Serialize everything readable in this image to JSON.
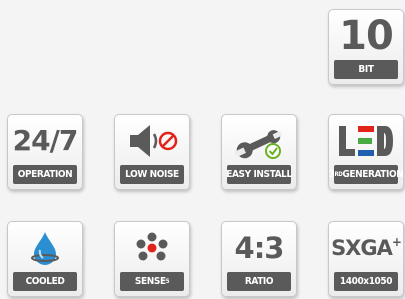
{
  "badges": [
    {
      "name": "10bit",
      "top_text": "10",
      "label": "BIT"
    },
    {
      "name": "operation",
      "top_text": "24/7",
      "label": "OPERATION"
    },
    {
      "name": "low-noise",
      "label": "LOW NOISE"
    },
    {
      "name": "easy-install",
      "label": "EASY INSTALL"
    },
    {
      "name": "led",
      "top_text": "LED",
      "label_pre": "3",
      "label_sup": "RD",
      "label_post": "GENERATION"
    },
    {
      "name": "cooled",
      "label": "COOLED"
    },
    {
      "name": "sense",
      "label_pre": "SENSE",
      "label_sup": "5"
    },
    {
      "name": "ratio",
      "top_text": "4:3",
      "label": "RATIO"
    },
    {
      "name": "sxga",
      "top_text": "SXGA",
      "top_sup": "+",
      "label": "1400x1050"
    }
  ],
  "colors": {
    "badge_strip": "#5a5a5a",
    "drop_blue": "#2a8ed0",
    "no_sign_red": "#e2231a",
    "check_green": "#6ab023",
    "led_red": "#e2231a",
    "led_green": "#49a942",
    "led_blue": "#1f5fae"
  },
  "icons": [
    "speaker-no-sound-icon",
    "wrench-check-icon",
    "water-drop-icon",
    "sensor-dots-icon"
  ]
}
